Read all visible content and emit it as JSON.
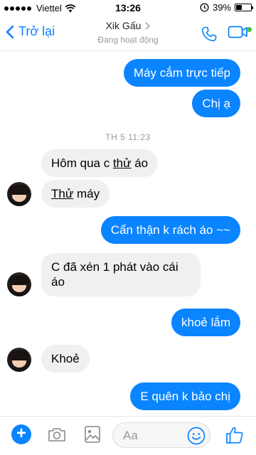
{
  "status_bar": {
    "carrier": "Viettel",
    "time": "13:26",
    "battery_percent": "39%",
    "battery_level": 0.39
  },
  "header": {
    "back_label": "Trở lại",
    "contact_name": "Xik Gấu",
    "contact_status": "Đang hoạt động"
  },
  "messages": {
    "m1": "Máy cắm trực tiếp",
    "m2": "Chị ạ",
    "timestamp": "TH 5 11:23",
    "m3_prefix": "Hôm qua c ",
    "m3_underlined": "thử",
    "m3_suffix": " áo",
    "m4_underlined": "Thử",
    "m4_suffix": " máy",
    "m5": "Cẩn thận k rách áo ~~",
    "m6_line1": "C đã xén 1 phát vào cái",
    "m6_line2": "áo",
    "m7": "khoẻ lắm",
    "m8": "Khoẻ",
    "m9": "E quên k bảo chị"
  },
  "composer": {
    "placeholder": "Aa"
  },
  "colors": {
    "accent": "#0a84ff",
    "incoming_bubble": "#f0f0f0",
    "online": "#44c24a"
  },
  "icons": [
    "back-chevron-icon",
    "chevron-right-icon",
    "phone-icon",
    "video-icon",
    "plus-icon",
    "camera-icon",
    "image-icon",
    "emoji-icon",
    "thumbs-up-icon",
    "wifi-icon",
    "alarm-lock-icon"
  ]
}
